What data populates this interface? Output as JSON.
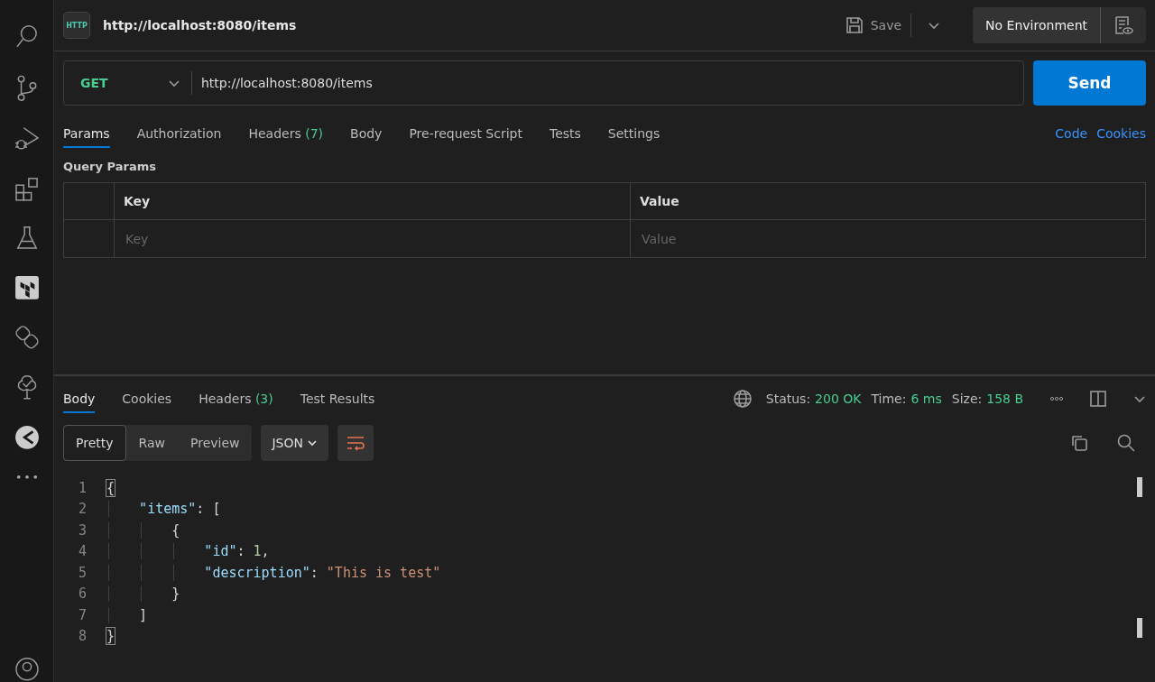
{
  "header": {
    "badge": "HTTP",
    "title": "http://localhost:8080/items",
    "save": "Save",
    "environment": "No Environment"
  },
  "request": {
    "method": "GET",
    "url": "http://localhost:8080/items",
    "send": "Send"
  },
  "request_tabs": [
    {
      "label": "Params",
      "selected": true
    },
    {
      "label": "Authorization",
      "selected": false
    },
    {
      "label": "Headers",
      "count": "(7)",
      "selected": false
    },
    {
      "label": "Body",
      "selected": false
    },
    {
      "label": "Pre-request Script",
      "selected": false
    },
    {
      "label": "Tests",
      "selected": false
    },
    {
      "label": "Settings",
      "selected": false
    }
  ],
  "request_links": [
    "Code",
    "Cookies"
  ],
  "query_params": {
    "title": "Query Params",
    "columns": [
      "Key",
      "Value"
    ],
    "placeholders": [
      "Key",
      "Value"
    ]
  },
  "response_tabs": [
    {
      "label": "Body",
      "selected": true
    },
    {
      "label": "Cookies",
      "selected": false
    },
    {
      "label": "Headers",
      "count": "(3)",
      "selected": false
    },
    {
      "label": "Test Results",
      "selected": false
    }
  ],
  "response_status": [
    {
      "label": "Status:",
      "value": "200 OK"
    },
    {
      "label": "Time:",
      "value": "6 ms"
    },
    {
      "label": "Size:",
      "value": "158 B"
    }
  ],
  "view_modes": [
    {
      "label": "Pretty",
      "selected": true
    },
    {
      "label": "Raw",
      "selected": false
    },
    {
      "label": "Preview",
      "selected": false
    }
  ],
  "format": "JSON",
  "code_lines": [
    {
      "number": "1",
      "tokens": [
        {
          "kind": "bracket",
          "text": "{"
        }
      ]
    },
    {
      "number": "2",
      "tokens": [
        {
          "kind": "key",
          "text": "\"items\""
        },
        {
          "kind": "punct",
          "text": ": ["
        }
      ]
    },
    {
      "number": "3",
      "tokens": [
        {
          "kind": "punct",
          "text": "{"
        }
      ]
    },
    {
      "number": "4",
      "tokens": [
        {
          "kind": "key",
          "text": "\"id\""
        },
        {
          "kind": "punct",
          "text": ": "
        },
        {
          "kind": "number",
          "text": "1"
        },
        {
          "kind": "punct",
          "text": ","
        }
      ]
    },
    {
      "number": "5",
      "tokens": [
        {
          "kind": "key",
          "text": "\"description\""
        },
        {
          "kind": "punct",
          "text": ": "
        },
        {
          "kind": "string",
          "text": "\"This is test\""
        }
      ]
    },
    {
      "number": "6",
      "tokens": [
        {
          "kind": "punct",
          "text": "}"
        }
      ]
    },
    {
      "number": "7",
      "tokens": [
        {
          "kind": "punct",
          "text": "]"
        }
      ]
    },
    {
      "number": "8",
      "tokens": [
        {
          "kind": "bracket",
          "text": "}"
        }
      ]
    }
  ]
}
